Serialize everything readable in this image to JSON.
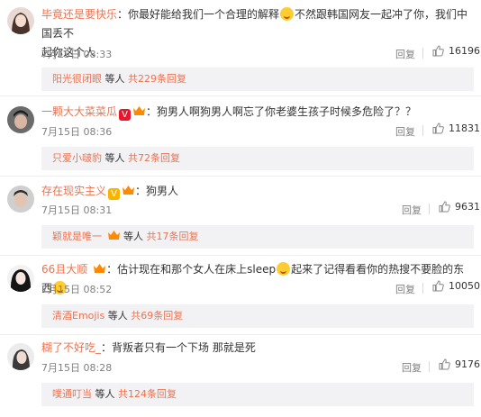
{
  "comments": [
    {
      "username": "毕竟还是要快乐",
      "text_a": "：你最好能给我们一个合理的解释",
      "text_b": "不然跟韩国网友一起冲了你，我们中国丢不",
      "text_c": "起你这个人",
      "time": "7月15日 08:33",
      "reply_label": "回复",
      "likes": "16196",
      "sub_user": "阳光很闭眼",
      "sub_mid": " 等人 ",
      "sub_count": "共229条回复"
    },
    {
      "username": "一颗大大菜菜瓜",
      "text_a": "：狗男人啊狗男人啊忘了你老婆生孩子时候多危险了？？",
      "time": "7月15日 08:36",
      "reply_label": "回复",
      "likes": "11831",
      "sub_user": "只爱小啵豹",
      "sub_mid": " 等人 ",
      "sub_count": "共72条回复"
    },
    {
      "username": "存在现实主义",
      "text_a": "：狗男人",
      "time": "7月15日 08:31",
      "reply_label": "回复",
      "likes": "9631",
      "sub_user": "颖就是唯一",
      "sub_mid": " 等人 ",
      "sub_count": "共17条回复"
    },
    {
      "username": "66且大顺",
      "text_a": "：估计现在和那个女人在床上sleep",
      "text_b": "起来了记得看看你的热搜不要脸的东西",
      "time": "7月15日 08:52",
      "reply_label": "回复",
      "likes": "10050",
      "sub_user": "清酒Emojis",
      "sub_mid": " 等人 ",
      "sub_count": "共69条回复"
    },
    {
      "username": "糊了不好吃_",
      "text_a": "：背叛者只有一个下场 那就是死",
      "time": "7月15日 08:28",
      "reply_label": "回复",
      "likes": "9176",
      "sub_user": "噗通叮当",
      "sub_mid": " 等人 ",
      "sub_count": "共124条回复"
    }
  ]
}
